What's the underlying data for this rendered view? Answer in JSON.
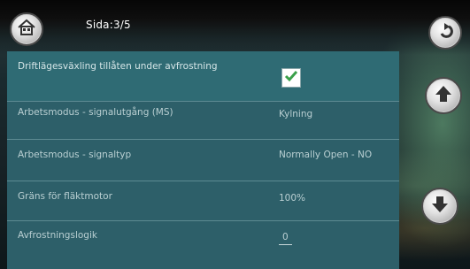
{
  "header": {
    "page_label": "Sida:3/5"
  },
  "icons": {
    "home": "home-icon",
    "back": "back-arrow-icon",
    "scroll_up": "arrow-up-icon",
    "scroll_down": "arrow-down-icon",
    "check": "checkmark-icon"
  },
  "settings": [
    {
      "label": "Driftlägesväxling tillåten under avfrostning",
      "checked": true
    },
    {
      "label": "Arbetsmodus - signalutgång (MS)",
      "value": "Kylning"
    },
    {
      "label": "Arbetsmodus - signaltyp",
      "value": "Normally Open - NO"
    },
    {
      "label": "Gräns för fläktmotor",
      "value": "100%"
    },
    {
      "label": "Avfrostningslogik",
      "value": "0"
    }
  ],
  "colors": {
    "panel": "#2d5f69",
    "check_green": "#3aa04a"
  }
}
